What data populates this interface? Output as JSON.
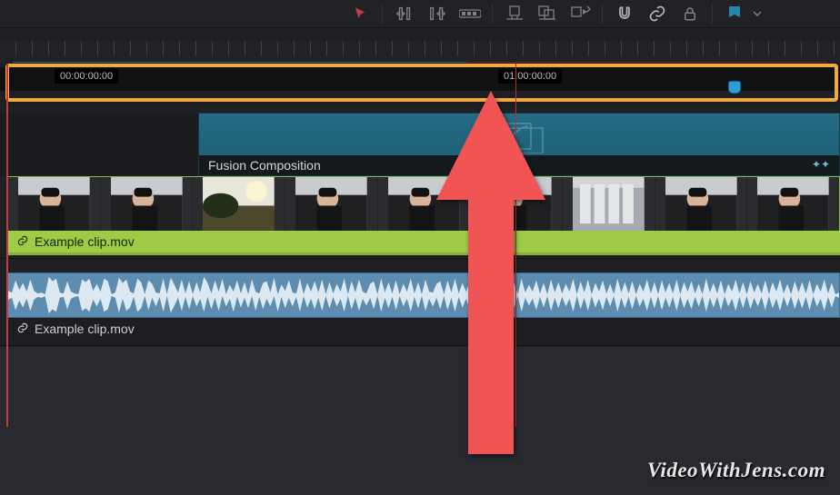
{
  "toolbar": {
    "tools": [
      {
        "id": "selection-tool",
        "icon": "cursor"
      },
      {
        "id": "trim-in-tool",
        "icon": "trim-in"
      },
      {
        "id": "trim-out-tool",
        "icon": "trim-out"
      },
      {
        "id": "razor-tool",
        "icon": "razor"
      },
      {
        "id": "position-lock-tool",
        "icon": "pos-lock"
      },
      {
        "id": "replace-tool",
        "icon": "replace"
      },
      {
        "id": "insert-tool",
        "icon": "insert"
      },
      {
        "id": "snap-toggle",
        "icon": "magnet"
      },
      {
        "id": "link-toggle",
        "icon": "link"
      },
      {
        "id": "lock-toggle",
        "icon": "lock"
      },
      {
        "id": "flag-marker",
        "icon": "flag"
      }
    ]
  },
  "ruler": {
    "timecode_left": "00:00:00:00",
    "timecode_right": "01:00:00:00"
  },
  "tracks": {
    "fusion": {
      "label": "Fusion Composition"
    },
    "video": {
      "label": "Example clip.mov"
    },
    "audio": {
      "label": "Example clip.mov"
    }
  },
  "annotation": {
    "arrow_color": "#f15454",
    "highlight_color": "#f2a93e"
  },
  "watermark": "VideoWithJens.com"
}
